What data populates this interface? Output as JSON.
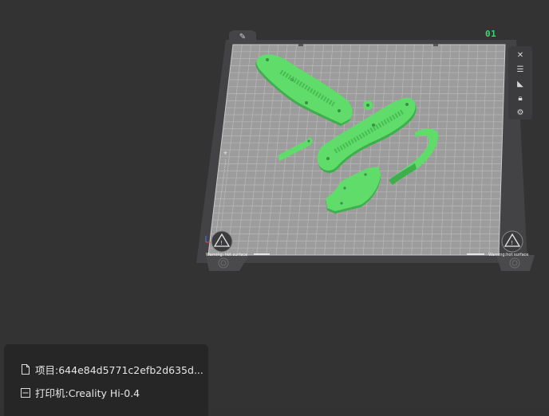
{
  "plate": {
    "number": "01",
    "warning_left": "Warning: hot surface",
    "warning_right": "Warning:hot surface"
  },
  "toolbar": {
    "edit_tab_icon": "pencil-icon",
    "buttons": [
      "close-icon",
      "list-icon",
      "auto-orient-icon",
      "lock-icon",
      "gear-icon"
    ]
  },
  "info": {
    "project_icon": "file-icon",
    "project_label": "项目:644e84d5771c2efb2d635d...",
    "printer_icon": "printer-icon",
    "printer_label": "打印机:Creality Hi-0.4"
  },
  "colors": {
    "part": "#5fdc6a",
    "part_shadow": "#3fae4c",
    "plate": "#9b9b9b",
    "grid": "#b9b9b9",
    "accent": "#2fdc73"
  }
}
